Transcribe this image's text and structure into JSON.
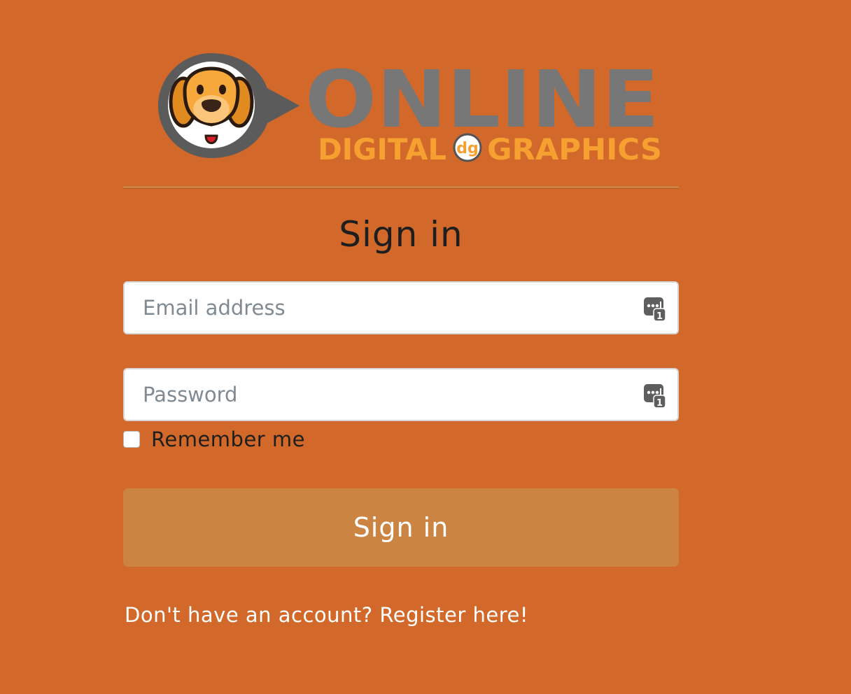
{
  "brand": {
    "logo_word_top": "ONLINE",
    "logo_word_left": "DIGITAL",
    "logo_badge": "dg",
    "logo_word_right": "GRAPHICS",
    "mascot_icon": "dog-head-icon"
  },
  "form": {
    "title": "Sign in",
    "email": {
      "placeholder": "Email address",
      "value": ""
    },
    "password": {
      "placeholder": "Password",
      "value": ""
    },
    "password_manager_icon": "password-manager-icon",
    "remember_label": "Remember me",
    "remember_checked": false,
    "submit_label": "Sign in"
  },
  "footer": {
    "register_prompt": "Don't have an account?",
    "register_link": "Register here!"
  },
  "colors": {
    "background": "#D2692A",
    "button": "#CC8443",
    "logo_gray": "#777777",
    "logo_orange": "#F5A030"
  }
}
